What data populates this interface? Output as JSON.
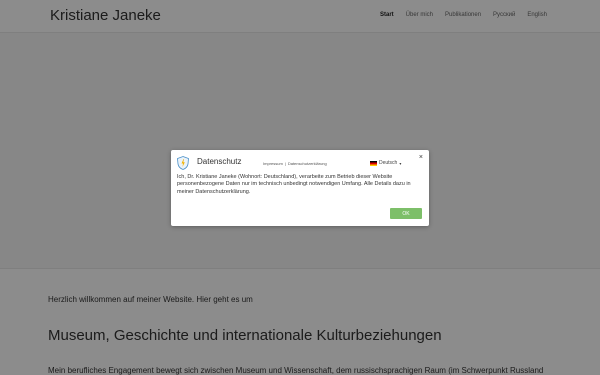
{
  "site": {
    "title": "Kristiane Janeke",
    "nav": [
      "Start",
      "Über mich",
      "Publikationen",
      "Русский",
      "English"
    ]
  },
  "main": {
    "welcome": "Herzlich willkommen auf meiner Website. Hier geht es um",
    "heading": "Museum, Geschichte und internationale Kulturbeziehungen",
    "paragraph": "Mein berufliches Engagement bewegt sich zwischen Museum und Wissenschaft, dem russischsprachigen Raum (im Schwerpunkt Russland"
  },
  "dialog": {
    "title": "Datenschutz",
    "link_impressum": "Impressum",
    "link_separator": "|",
    "link_privacy": "Datenschutzerklärung",
    "language": "Deutsch",
    "close": "×",
    "body": "Ich, Dr. Kristiane Janeke (Wohnort: Deutschland), verarbeite zum Betrieb dieser Website personenbezogene Daten nur im technisch unbedingt notwendigen Umfang. Alle Details dazu in meiner Datenschutzerklärung.",
    "ok": "OK"
  },
  "colors": {
    "accent": "#7dbf69",
    "overlay": "rgba(0,0,0,0.45)"
  }
}
